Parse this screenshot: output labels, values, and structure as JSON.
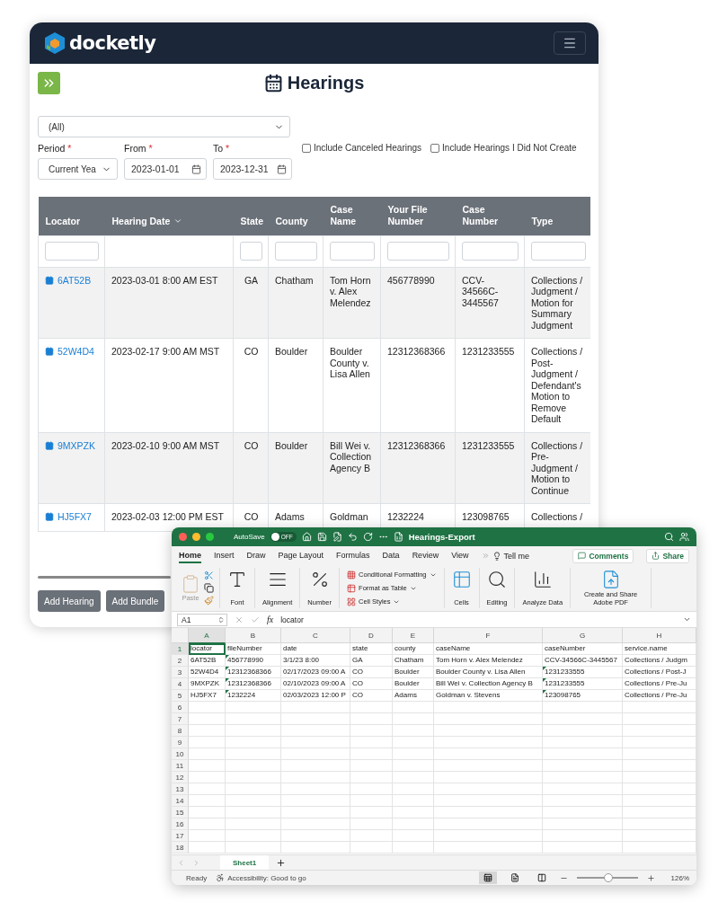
{
  "app": {
    "brand": "docketly",
    "title": "Hearings",
    "scope_select": {
      "value": "(All)"
    },
    "filters": [
      {
        "label": "Period",
        "mark": "*",
        "kind": "select",
        "value": "Current Yea"
      },
      {
        "label": "From",
        "mark": "*",
        "kind": "date",
        "value": "2023-01-01"
      },
      {
        "label": "To",
        "mark": "*",
        "kind": "date",
        "value": "2023-12-31"
      }
    ],
    "options": [
      {
        "label": "Include Canceled Hearings",
        "checked": false
      },
      {
        "label": "Include Hearings I Did Not Create",
        "checked": false
      }
    ],
    "table": {
      "columns": [
        {
          "label": "Locator",
          "sorted": false,
          "filter": true
        },
        {
          "label": "Hearing Date",
          "sorted": true,
          "filter": false
        },
        {
          "label": "State",
          "sorted": false,
          "filter": true
        },
        {
          "label": "County",
          "sorted": false,
          "filter": true
        },
        {
          "label": "Case Name",
          "sorted": false,
          "filter": true
        },
        {
          "label": "Your File Number",
          "sorted": false,
          "filter": true
        },
        {
          "label": "Case Number",
          "sorted": false,
          "filter": true
        },
        {
          "label": "Type",
          "sorted": false,
          "filter": true
        }
      ],
      "rows": [
        {
          "locator": "6AT52B",
          "date": "2023-03-01 8:00 AM EST",
          "state": "GA",
          "county": "Chatham",
          "case_name": "Tom Horn v. Alex Melendez",
          "file_number": "456778990",
          "case_number": "CCV-34566C-3445567",
          "type": "Collections / Judgment / Motion for Summary Judgment"
        },
        {
          "locator": "52W4D4",
          "date": "2023-02-17 9:00 AM MST",
          "state": "CO",
          "county": "Boulder",
          "case_name": "Boulder County v. Lisa Allen",
          "file_number": "12312368366",
          "case_number": "1231233555",
          "type": "Collections / Post-Judgment / Defendant's Motion to Remove Default"
        },
        {
          "locator": "9MXPZK",
          "date": "2023-02-10 9:00 AM MST",
          "state": "CO",
          "county": "Boulder",
          "case_name": "Bill Wei v. Collection Agency B",
          "file_number": "12312368366",
          "case_number": "1231233555",
          "type": "Collections / Pre-Judgment / Motion to Continue"
        },
        {
          "locator": "HJ5FX7",
          "date": "2023-02-03 12:00 PM EST",
          "state": "CO",
          "county": "Adams",
          "case_name": "Goldman",
          "file_number": "1232224",
          "case_number": "123098765",
          "type": "Collections /"
        }
      ]
    },
    "buttons": [
      "Add Hearing",
      "Add Bundle"
    ]
  },
  "excel": {
    "title": "Hearings-Export",
    "autosave": {
      "label": "AutoSave",
      "on": false,
      "state_label": "OFF"
    },
    "menu_tabs": [
      {
        "label": "Home",
        "selected": true
      },
      {
        "label": "Insert",
        "selected": false
      },
      {
        "label": "Draw",
        "selected": false
      },
      {
        "label": "Page Layout",
        "selected": false
      },
      {
        "label": "Formulas",
        "selected": false
      },
      {
        "label": "Data",
        "selected": false
      },
      {
        "label": "Review",
        "selected": false
      },
      {
        "label": "View",
        "selected": false
      }
    ],
    "tell_me": "Tell me",
    "comments": "Comments",
    "share": "Share",
    "ribbon": [
      {
        "kind": "paste",
        "label": "Paste",
        "disabled": true
      },
      {
        "kind": "font",
        "label": "Font"
      },
      {
        "kind": "alignment",
        "label": "Alignment"
      },
      {
        "kind": "number",
        "label": "Number"
      },
      {
        "kind": "styles",
        "items": [
          "Conditional Formatting",
          "Format as Table",
          "Cell Styles"
        ]
      },
      {
        "kind": "cells",
        "label": "Cells"
      },
      {
        "kind": "editing",
        "label": "Editing"
      },
      {
        "kind": "analyze",
        "label": "Analyze Data"
      },
      {
        "kind": "pdf",
        "label": "Create and Share Adobe PDF"
      }
    ],
    "name_box": "A1",
    "fx": "fx",
    "formula": "locator",
    "columns": [
      {
        "label": "A",
        "selected": true
      },
      {
        "label": "B",
        "selected": false
      },
      {
        "label": "C",
        "selected": false
      },
      {
        "label": "D",
        "selected": false
      },
      {
        "label": "E",
        "selected": false
      },
      {
        "label": "F",
        "selected": false
      },
      {
        "label": "G",
        "selected": false
      },
      {
        "label": "H",
        "selected": false
      }
    ],
    "rows": [
      {
        "number": "1",
        "selected": true,
        "cells": [
          {
            "text": "locator",
            "marked": false
          },
          {
            "text": "fileNumber",
            "marked": false
          },
          {
            "text": "date",
            "marked": false
          },
          {
            "text": "state",
            "marked": false
          },
          {
            "text": "county",
            "marked": false
          },
          {
            "text": "caseName",
            "marked": false
          },
          {
            "text": "caseNumber",
            "marked": false
          },
          {
            "text": "service.name",
            "marked": false
          }
        ]
      },
      {
        "number": "2",
        "selected": false,
        "cells": [
          {
            "text": "6AT52B",
            "marked": false
          },
          {
            "text": "456778990",
            "marked": true
          },
          {
            "text": "3/1/23 8:00",
            "marked": false
          },
          {
            "text": "GA",
            "marked": false
          },
          {
            "text": "Chatham",
            "marked": false
          },
          {
            "text": "Tom Horn v. Alex Melendez",
            "marked": false
          },
          {
            "text": "CCV-34566C-3445567",
            "marked": false
          },
          {
            "text": "Collections / Judgm",
            "marked": false
          }
        ]
      },
      {
        "number": "3",
        "selected": false,
        "cells": [
          {
            "text": "52W4D4",
            "marked": false
          },
          {
            "text": "12312368366",
            "marked": true
          },
          {
            "text": "02/17/2023 09:00 A",
            "marked": false
          },
          {
            "text": "CO",
            "marked": false
          },
          {
            "text": "Boulder",
            "marked": false
          },
          {
            "text": "Boulder County v. Lisa Allen",
            "marked": false
          },
          {
            "text": "1231233555",
            "marked": true
          },
          {
            "text": "Collections / Post-J",
            "marked": false
          }
        ]
      },
      {
        "number": "4",
        "selected": false,
        "cells": [
          {
            "text": "9MXPZK",
            "marked": false
          },
          {
            "text": "12312368366",
            "marked": true
          },
          {
            "text": "02/10/2023 09:00 A",
            "marked": false
          },
          {
            "text": "CO",
            "marked": false
          },
          {
            "text": "Boulder",
            "marked": false
          },
          {
            "text": "Bill Wei v. Collection Agency B",
            "marked": false
          },
          {
            "text": "1231233555",
            "marked": true
          },
          {
            "text": "Collections / Pre-Ju",
            "marked": false
          }
        ]
      },
      {
        "number": "5",
        "selected": false,
        "cells": [
          {
            "text": "HJ5FX7",
            "marked": false
          },
          {
            "text": "1232224",
            "marked": true
          },
          {
            "text": "02/03/2023 12:00 P",
            "marked": false
          },
          {
            "text": "CO",
            "marked": false
          },
          {
            "text": "Adams",
            "marked": false
          },
          {
            "text": "Goldman v. Stevens",
            "marked": false
          },
          {
            "text": "123098765",
            "marked": true
          },
          {
            "text": "Collections / Pre-Ju",
            "marked": false
          }
        ]
      },
      {
        "number": "6",
        "selected": false
      },
      {
        "number": "7",
        "selected": false
      },
      {
        "number": "8",
        "selected": false
      },
      {
        "number": "9",
        "selected": false
      },
      {
        "number": "10",
        "selected": false
      },
      {
        "number": "11",
        "selected": false
      },
      {
        "number": "12",
        "selected": false
      },
      {
        "number": "13",
        "selected": false
      },
      {
        "number": "14",
        "selected": false
      },
      {
        "number": "15",
        "selected": false
      },
      {
        "number": "16",
        "selected": false
      },
      {
        "number": "17",
        "selected": false
      },
      {
        "number": "18",
        "selected": false
      }
    ],
    "sheet_tabs": [
      {
        "label": "Sheet1",
        "selected": true
      }
    ],
    "status": {
      "ready": "Ready",
      "accessibility": "Accessibility: Good to go",
      "views": [
        {
          "selected": true
        },
        {
          "selected": false
        },
        {
          "selected": false
        }
      ],
      "zoom": {
        "level": 0.52,
        "reading": "126%"
      }
    }
  }
}
